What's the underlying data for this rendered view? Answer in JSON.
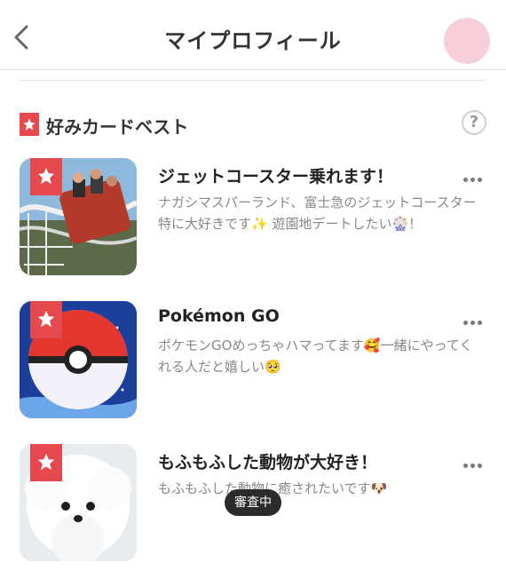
{
  "header": {
    "title": "マイプロフィール"
  },
  "section": {
    "title": "好みカードベスト",
    "help": "?"
  },
  "cards": [
    {
      "title": "ジェットコースター乗れます！",
      "description": "ナガシマスパーランド、富士急のジェットコースター特に大好きです✨ 遊園地デートしたい🎡！"
    },
    {
      "title": "Pokémon GO",
      "description": "ポケモンGOめっちゃハマってます🥰一緒にやってくれる人だと嬉しい🥺"
    },
    {
      "title": "もふもふした動物が大好き！",
      "description": "もふもふした動物に癒されたいです🐶"
    }
  ],
  "toast": {
    "label": "審査中"
  },
  "colors": {
    "accent": "#e5484d",
    "avatar": "#f6cfdb"
  }
}
